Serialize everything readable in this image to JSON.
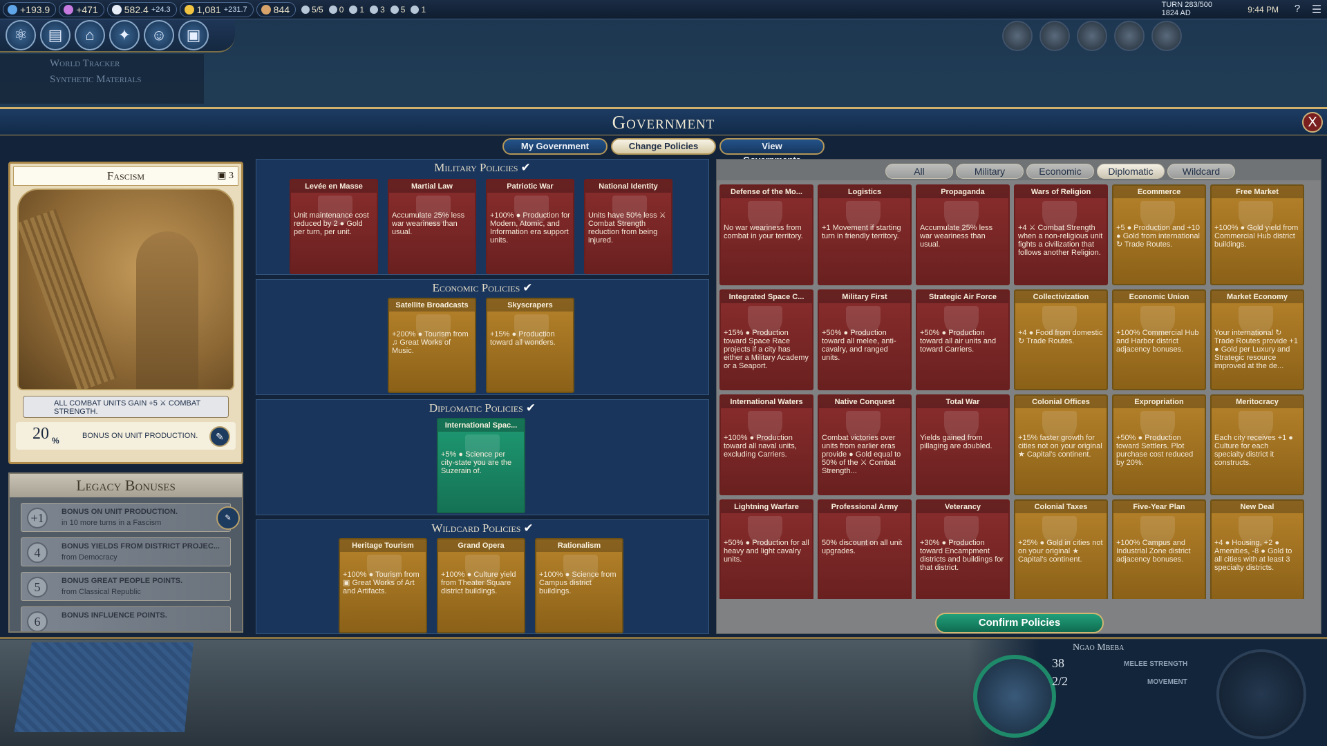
{
  "topbar": {
    "science": "+193.9",
    "culture": "+471",
    "faith": "582.4",
    "faith_rate": "+24.3",
    "gold": "1,081",
    "gold_rate": "+231.7",
    "tourism": "844",
    "trade": "5/5",
    "envoys": "0",
    "great_people": [
      "1",
      "3",
      "5",
      "1"
    ],
    "turn": "TURN 283/500",
    "year": "1824 AD",
    "time": "9:44 PM",
    "help": "?",
    "menu": "☰"
  },
  "launch_icons": [
    "science-icon",
    "civics-icon",
    "government-icon",
    "religion-icon",
    "great-people-icon",
    "great-works-icon"
  ],
  "tracker": {
    "title": "World Tracker",
    "research": "Synthetic Materials"
  },
  "window": {
    "title": "Government",
    "close": "X",
    "tabs": [
      "My Government",
      "Change Policies",
      "View Governments"
    ],
    "active_tab": "Change Policies"
  },
  "government": {
    "name": "Fascism",
    "slots": "3",
    "bonus_main": "ALL COMBAT UNITS GAIN +5 ⚔ COMBAT STRENGTH.",
    "bonus_num": "20",
    "bonus_pct": "%",
    "bonus_text": "BONUS ON UNIT PRODUCTION."
  },
  "legacy": {
    "title": "Legacy Bonuses",
    "rows": [
      {
        "num": "+1",
        "title": "BONUS ON UNIT PRODUCTION.",
        "sub": "in 10 more turns in a Fascism"
      },
      {
        "num": "4",
        "title": "BONUS YIELDS FROM DISTRICT PROJEC...",
        "sub": "from Democracy"
      },
      {
        "num": "5",
        "title": "BONUS GREAT PEOPLE POINTS.",
        "sub": "from Classical Republic"
      },
      {
        "num": "6",
        "title": "BONUS INFLUENCE POINTS.",
        "sub": ""
      }
    ]
  },
  "sections": {
    "military": "Military Policies",
    "economic": "Economic Policies",
    "diplomatic": "Diplomatic Policies",
    "wildcard": "Wildcard Policies",
    "check": "✔"
  },
  "military_slots": [
    {
      "name": "Levée en Masse",
      "desc": "Unit maintenance cost reduced by 2 ● Gold per turn, per unit."
    },
    {
      "name": "Martial Law",
      "desc": "Accumulate 25% less war weariness than usual."
    },
    {
      "name": "Patriotic War",
      "desc": "+100% ● Production for Modern, Atomic, and Information era support units."
    },
    {
      "name": "National Identity",
      "desc": "Units have 50% less ⚔ Combat Strength reduction from being injured."
    }
  ],
  "economic_slots": [
    {
      "name": "Satellite Broadcasts",
      "desc": "+200% ● Tourism from ♫ Great Works of Music."
    },
    {
      "name": "Skyscrapers",
      "desc": "+15% ● Production toward all wonders."
    }
  ],
  "diplomatic_slots": [
    {
      "name": "International Spac...",
      "desc": "+5% ● Science per city-state you are the Suzerain of."
    }
  ],
  "wildcard_slots": [
    {
      "name": "Heritage Tourism",
      "desc": "+100% ● Tourism from ▣ Great Works of Art and Artifacts."
    },
    {
      "name": "Grand Opera",
      "desc": "+100% ● Culture yield from Theater Square district buildings."
    },
    {
      "name": "Rationalism",
      "desc": "+100% ● Science from Campus district buildings."
    }
  ],
  "catalog": {
    "filters": [
      "All",
      "Military",
      "Economic",
      "Diplomatic",
      "Wildcard"
    ],
    "active_filter": "Diplomatic",
    "confirm": "Confirm Policies",
    "cards": [
      {
        "name": "Defense of the Mo...",
        "type": "mil",
        "desc": "No war weariness from combat in your territory."
      },
      {
        "name": "Logistics",
        "type": "mil",
        "desc": "+1 Movement if starting turn in friendly territory."
      },
      {
        "name": "Propaganda",
        "type": "mil",
        "desc": "Accumulate 25% less war weariness than usual."
      },
      {
        "name": "Wars of Religion",
        "type": "mil",
        "desc": "+4 ⚔ Combat Strength when a non-religious unit fights a civilization that follows another Religion."
      },
      {
        "name": "Ecommerce",
        "type": "econ",
        "desc": "+5 ● Production and +10 ● Gold from international ↻ Trade Routes."
      },
      {
        "name": "Free Market",
        "type": "econ",
        "desc": "+100% ● Gold yield from Commercial Hub district buildings."
      },
      {
        "name": "Integrated Space C...",
        "type": "mil",
        "desc": "+15% ● Production toward Space Race projects if a city has either a Military Academy or a Seaport."
      },
      {
        "name": "Military First",
        "type": "mil",
        "desc": "+50% ● Production toward all melee, anti-cavalry, and ranged units."
      },
      {
        "name": "Strategic Air Force",
        "type": "mil",
        "desc": "+50% ● Production toward all air units and toward Carriers."
      },
      {
        "name": "Collectivization",
        "type": "econ",
        "desc": "+4 ● Food from domestic ↻ Trade Routes."
      },
      {
        "name": "Economic Union",
        "type": "econ",
        "desc": "+100% Commercial Hub and Harbor district adjacency bonuses."
      },
      {
        "name": "Market Economy",
        "type": "econ",
        "desc": "Your international ↻ Trade Routes provide +1 ● Gold per Luxury and Strategic resource improved at the de..."
      },
      {
        "name": "International Waters",
        "type": "mil",
        "desc": "+100% ● Production toward all naval units, excluding Carriers."
      },
      {
        "name": "Native Conquest",
        "type": "mil",
        "desc": "Combat victories over units from earlier eras provide ● Gold equal to 50% of the ⚔ Combat Strength..."
      },
      {
        "name": "Total War",
        "type": "mil",
        "desc": "Yields gained from pillaging are doubled."
      },
      {
        "name": "Colonial Offices",
        "type": "econ",
        "desc": "+15% faster growth for cities not on your original ★ Capital's continent."
      },
      {
        "name": "Expropriation",
        "type": "econ",
        "desc": "+50% ● Production toward Settlers. Plot purchase cost reduced by 20%."
      },
      {
        "name": "Meritocracy",
        "type": "econ",
        "desc": "Each city receives +1 ● Culture for each specialty district it constructs."
      },
      {
        "name": "Lightning Warfare",
        "type": "mil",
        "desc": "+50% ● Production for all heavy and light cavalry units."
      },
      {
        "name": "Professional Army",
        "type": "mil",
        "desc": "50% discount on all unit upgrades."
      },
      {
        "name": "Veterancy",
        "type": "mil",
        "desc": "+30% ● Production toward Encampment districts and buildings for that district."
      },
      {
        "name": "Colonial Taxes",
        "type": "econ",
        "desc": "+25% ● Gold in cities not on your original ★ Capital's continent."
      },
      {
        "name": "Five-Year Plan",
        "type": "econ",
        "desc": "+100% Campus and Industrial Zone district adjacency bonuses."
      },
      {
        "name": "New Deal",
        "type": "econ",
        "desc": "+4 ● Housing, +2 ● Amenities, -8 ● Gold to all cities with at least 3 specialty districts."
      }
    ]
  },
  "unit": {
    "name": "Ngao Mbeba",
    "strength": "38",
    "strength_label": "MELEE STRENGTH",
    "movement": "2/2",
    "movement_label": "MOVEMENT"
  }
}
